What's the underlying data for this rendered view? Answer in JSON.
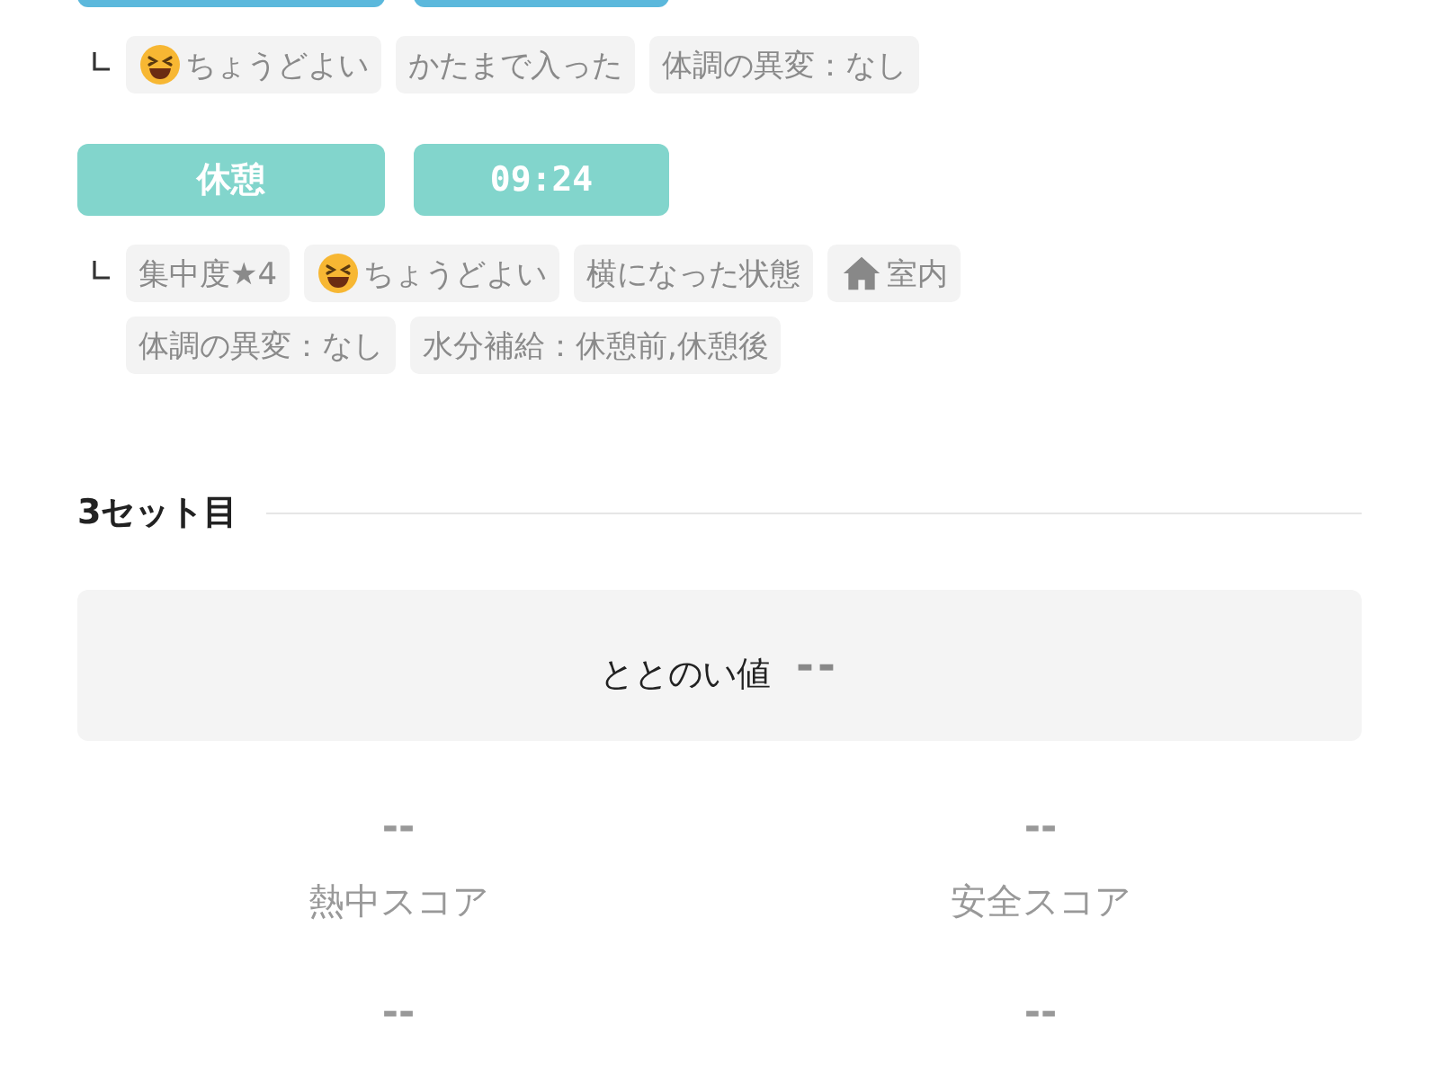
{
  "segments": [
    {
      "color": "#5bb8dc",
      "tags": [
        {
          "kind": "mood",
          "text": "ちょうどよい"
        },
        {
          "kind": "plain",
          "text": "かたまで入った"
        },
        {
          "kind": "plain",
          "text": "体調の異変：なし"
        }
      ]
    },
    {
      "color": "#82d5cc",
      "label": "休憩",
      "time": "09:24",
      "tags": [
        {
          "kind": "plain",
          "text": "集中度★4"
        },
        {
          "kind": "mood",
          "text": "ちょうどよい"
        },
        {
          "kind": "plain",
          "text": "横になった状態"
        },
        {
          "kind": "place",
          "text": "室内"
        },
        {
          "kind": "plain",
          "text": "体調の異変：なし"
        },
        {
          "kind": "plain",
          "text": "水分補給：休憩前,休憩後"
        }
      ]
    }
  ],
  "set_heading": "3セット目",
  "totonoi": {
    "label": "ととのい値",
    "value": "--"
  },
  "scores": [
    {
      "value": "--",
      "label": "熱中スコア"
    },
    {
      "value": "--",
      "label": "安全スコア"
    },
    {
      "value": "--"
    },
    {
      "value": "--"
    }
  ]
}
